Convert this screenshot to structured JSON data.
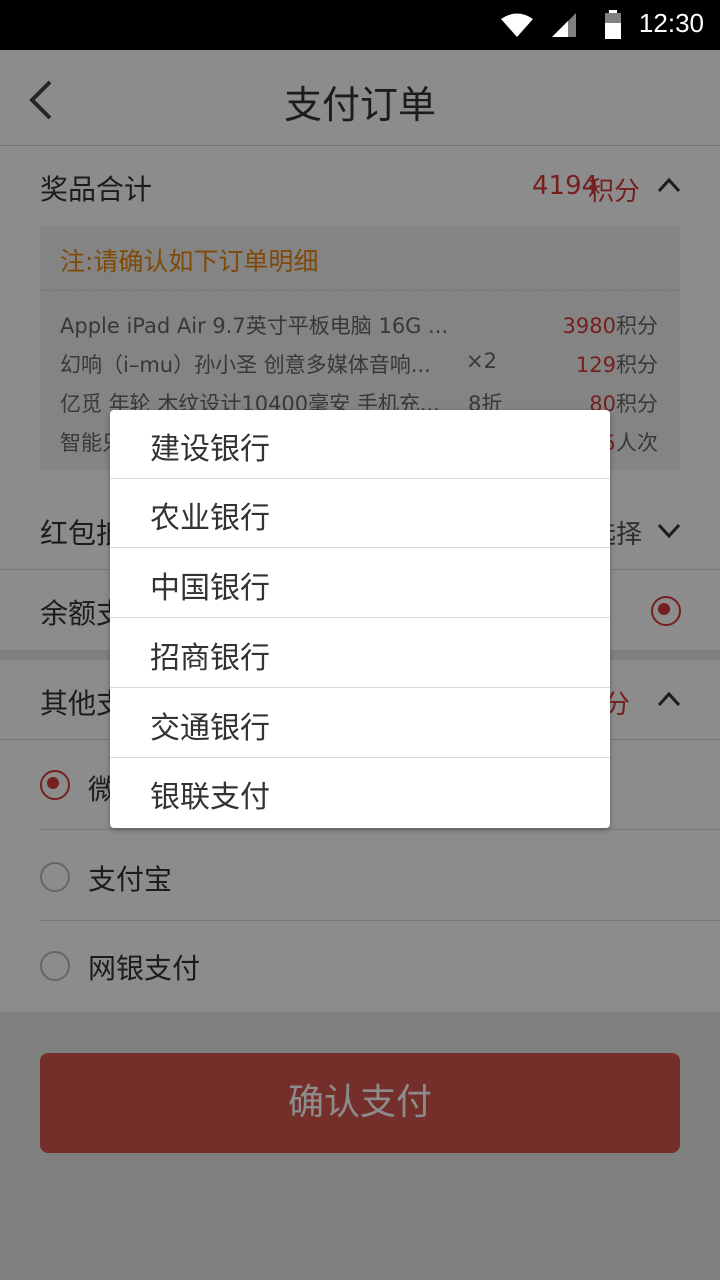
{
  "status_bar": {
    "time": "12:30"
  },
  "header": {
    "title": "支付订单"
  },
  "prize_section": {
    "label": "奖品合计",
    "total_value": "4194",
    "total_unit": "积分",
    "note": "注:请确认如下订单明细",
    "items": [
      {
        "name": "Apple iPad Air 9.7英寸平板电脑 16G ...",
        "mid": "",
        "value": "3980",
        "unit": "积分"
      },
      {
        "name": "幻响（i–mu）孙小圣 创意多媒体音响...",
        "mid": "×2",
        "value": "129",
        "unit": "积分"
      },
      {
        "name": "亿觅 年轮 木纹设计10400毫安 手机充...",
        "mid": "8折",
        "value": "80",
        "unit": "积分"
      },
      {
        "name": "智能只",
        "mid": "",
        "value": "5",
        "unit": "人次"
      }
    ]
  },
  "red_packet": {
    "label": "红包抵",
    "right": "选择"
  },
  "balance": {
    "label": "余额支"
  },
  "other_payment": {
    "label": "其他支",
    "right": "分",
    "options": [
      {
        "label": "微信支付",
        "selected": true
      },
      {
        "label": "支付宝",
        "selected": false
      },
      {
        "label": "网银支付",
        "selected": false
      }
    ]
  },
  "confirm_button": "确认支付",
  "bank_popup": {
    "items": [
      "建设银行",
      "农业银行",
      "中国银行",
      "招商银行",
      "交通银行",
      "银联支付"
    ]
  },
  "colors": {
    "accent": "#d83a3a",
    "note": "#e8870d",
    "button": "#d5574d"
  }
}
